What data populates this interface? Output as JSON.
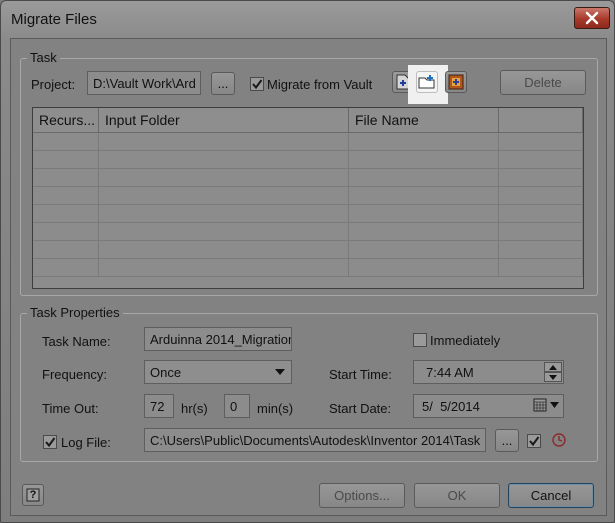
{
  "window": {
    "title": "Migrate Files"
  },
  "task": {
    "group_label": "Task",
    "project_label": "Project:",
    "project_value": "D:\\Vault Work\\Ard",
    "browse_label": "...",
    "migrate_from_vault_label": "Migrate from Vault",
    "migrate_from_vault_checked": true,
    "delete_label": "Delete",
    "columns": [
      "Recurs...",
      "Input Folder",
      "File Name",
      ""
    ]
  },
  "task_properties": {
    "group_label": "Task Properties",
    "task_name_label": "Task Name:",
    "task_name_value": "Arduinna 2014_Migration",
    "immediately_label": "Immediately",
    "immediately_checked": false,
    "frequency_label": "Frequency:",
    "frequency_value": "Once",
    "start_time_label": "Start Time:",
    "start_time_value": "7:44 AM",
    "time_out_label": "Time Out:",
    "time_out_hours": "72",
    "hours_unit": "hr(s)",
    "time_out_minutes": "0",
    "minutes_unit": "min(s)",
    "start_date_label": "Start Date:",
    "start_date_value": "5/  5/2014",
    "log_file_label": "Log File:",
    "log_file_checked": true,
    "log_file_value": "C:\\Users\\Public\\Documents\\Autodesk\\Inventor 2014\\Task",
    "log_browse_label": "...",
    "log_option_checked": true
  },
  "footer": {
    "help_label": "?",
    "options_label": "Options...",
    "ok_label": "OK",
    "cancel_label": "Cancel"
  },
  "colors": {
    "highlight": "#f0f0f0",
    "close_red": "#a8392a",
    "accent_blue": "#3050a8"
  },
  "icons": [
    "close-icon",
    "add-file-icon",
    "add-folder-icon",
    "import-task-icon",
    "calendar-icon",
    "clock-icon",
    "help-icon",
    "checkmark-icon"
  ]
}
